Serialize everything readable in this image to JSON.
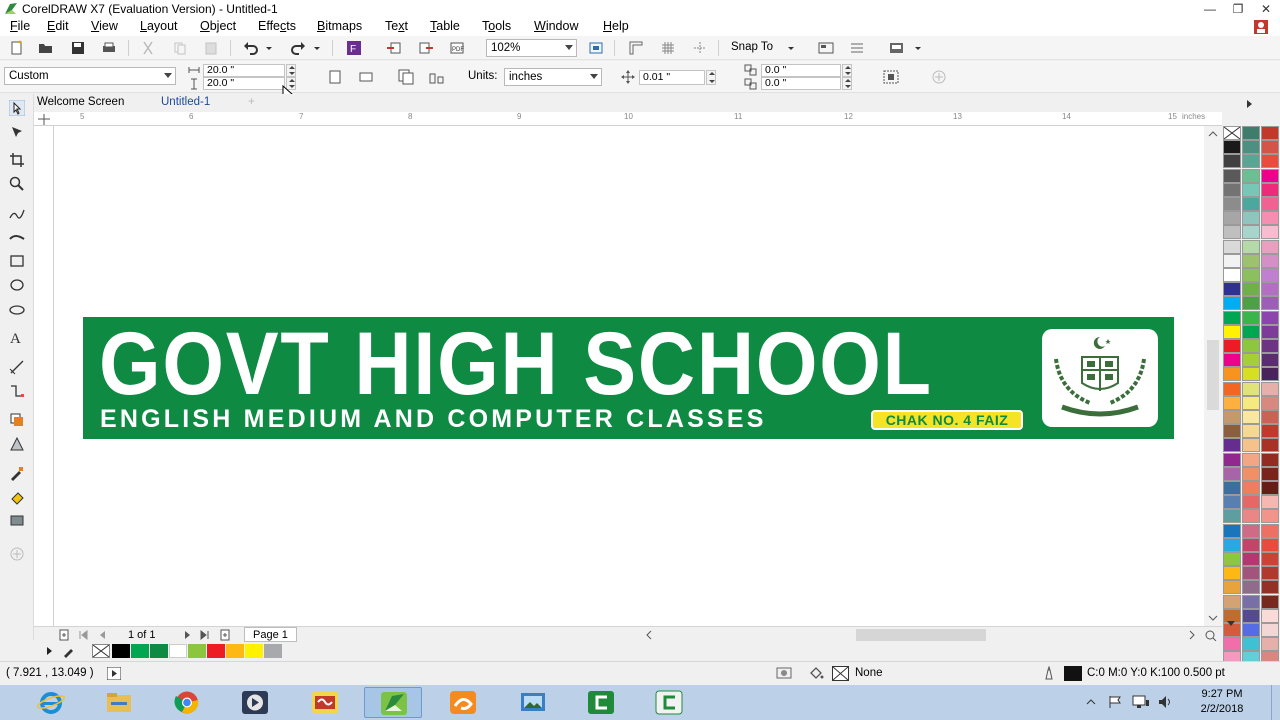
{
  "window": {
    "title": "CorelDRAW X7 (Evaluation Version) - Untitled-1"
  },
  "menu": [
    {
      "pre": "",
      "u": "F",
      "post": "ile"
    },
    {
      "pre": "",
      "u": "E",
      "post": "dit"
    },
    {
      "pre": "",
      "u": "V",
      "post": "iew"
    },
    {
      "pre": "",
      "u": "L",
      "post": "ayout"
    },
    {
      "pre": "",
      "u": "O",
      "post": "bject"
    },
    {
      "pre": "Effe",
      "u": "c",
      "post": "ts"
    },
    {
      "pre": "",
      "u": "B",
      "post": "itmaps"
    },
    {
      "pre": "Te",
      "u": "x",
      "post": "t"
    },
    {
      "pre": "",
      "u": "T",
      "post": "able"
    },
    {
      "pre": "T",
      "u": "o",
      "post": "ols"
    },
    {
      "pre": "",
      "u": "W",
      "post": "indow"
    },
    {
      "pre": "",
      "u": "H",
      "post": "elp"
    }
  ],
  "standard_toolbar": {
    "zoom": "102%",
    "snap_to": "Snap To"
  },
  "property_bar": {
    "page_preset": "Custom",
    "page_width": "20.0 \"",
    "page_height": "20.0 \"",
    "units_label": "Units:",
    "units_value": "inches",
    "nudge": "0.01 \"",
    "dup_x": "0.0 \"",
    "dup_y": "0.0 \""
  },
  "tabs": {
    "welcome": "Welcome Screen",
    "doc": "Untitled-1"
  },
  "ruler": {
    "h_labels": [
      "5",
      "6",
      "7",
      "8",
      "9",
      "10",
      "11",
      "12",
      "13",
      "14",
      "15"
    ],
    "unit": "inches"
  },
  "banner": {
    "headline": "GOVT HIGH SCHOOL",
    "subline": "ENGLISH MEDIUM AND COMPUTER CLASSES",
    "tag": "CHAK NO. 4 FAIZ",
    "bg_color": "#0e8a43",
    "tag_color": "#f4e425"
  },
  "page_nav": {
    "count": "1 of 1",
    "tab": "Page 1"
  },
  "status": {
    "coords": "( 7.921 , 13.049 )",
    "fill_label": "None",
    "outline": "C:0 M:0 Y:0 K:100  0.500 pt"
  },
  "taskbar": {
    "time": "9:27 PM",
    "date": "2/2/2018"
  }
}
